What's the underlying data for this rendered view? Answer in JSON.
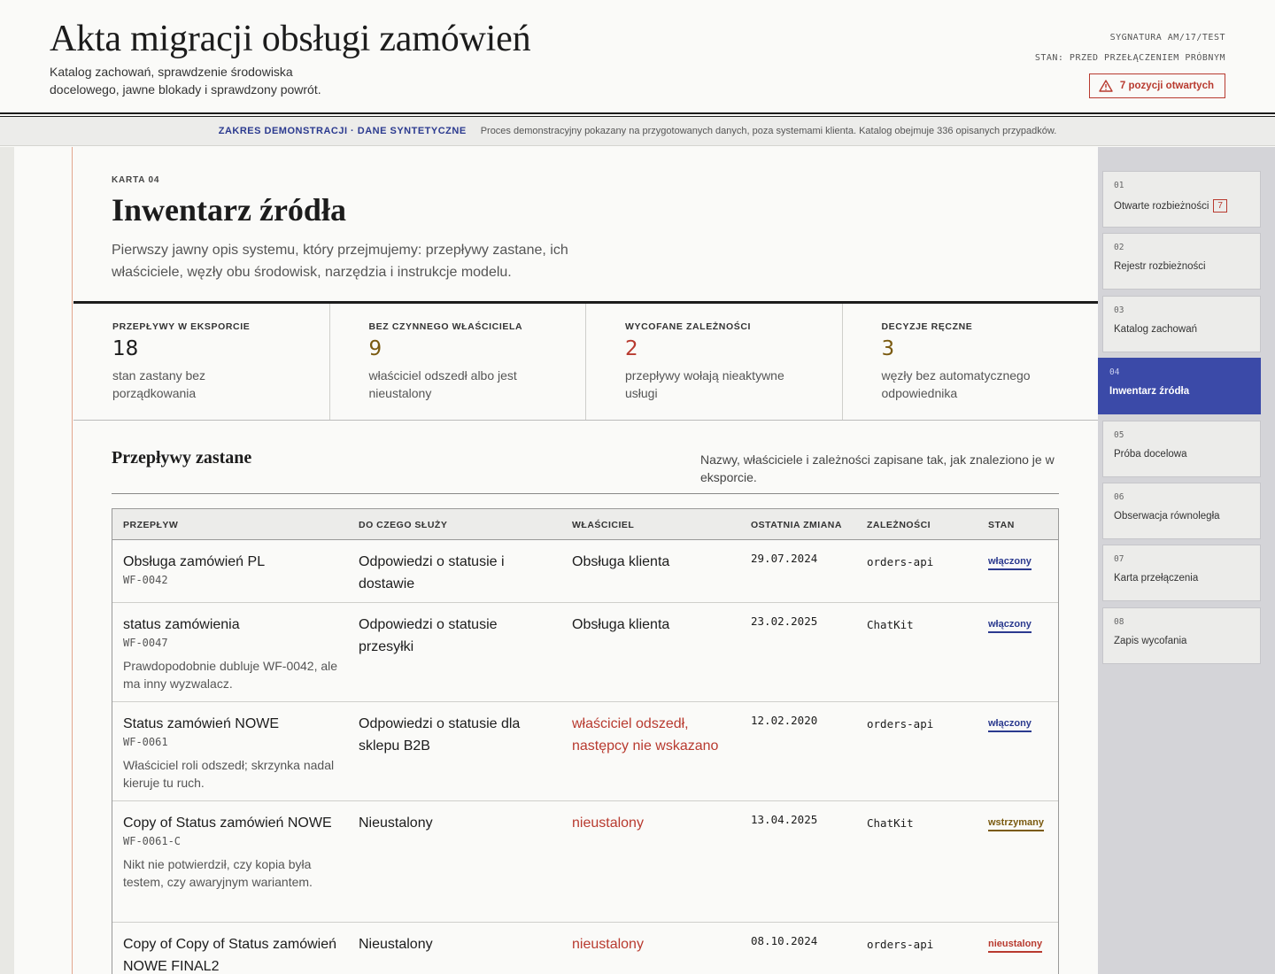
{
  "header": {
    "title": "Akta migracji obsługi zamówień",
    "subtitle": "Katalog zachowań, sprawdzenie środowiska docelowego, jawne blokady i sprawdzony powrót.",
    "signature": "SYGNATURA AM/17/TEST",
    "state": "STAN: PRZED PRZEŁĄCZENIEM PRÓBNYM",
    "open_items": "7 pozycji otwartych"
  },
  "scope": {
    "label": "ZAKRES DEMONSTRACJI · DANE SYNTETYCZNE",
    "text": "Proces demonstracyjny pokazany na przygotowanych danych, poza systemami klienta. Katalog obejmuje 336 opisanych przypadków."
  },
  "section": {
    "kicker": "KARTA 04",
    "title": "Inwentarz źródła",
    "description": "Pierwszy jawny opis systemu, który przejmujemy: przepływy zastane, ich właściciele, węzły obu środowisk, narzędzia i instrukcje modelu."
  },
  "stats": [
    {
      "label": "PRZEPŁYWY W EKSPORCIE",
      "value": "18",
      "note": "stan zastany bez porządkowania",
      "color": "#1c1c1c"
    },
    {
      "label": "BEZ CZYNNEGO WŁAŚCICIELA",
      "value": "9",
      "note": "właściciel odszedł albo jest nieustalony",
      "color": "#7a5a10"
    },
    {
      "label": "WYCOFANE ZALEŻNOŚCI",
      "value": "2",
      "note": "przepływy wołają nieaktywne usługi",
      "color": "#b83a2f"
    },
    {
      "label": "DECYZJE RĘCZNE",
      "value": "3",
      "note": "węzły bez automatycznego odpowiednika",
      "color": "#7a5a10"
    }
  ],
  "flows": {
    "title": "Przepływy zastane",
    "note": "Nazwy, właściciele i zależności zapisane tak, jak znaleziono je w eksporcie.",
    "columns": [
      "PRZEPŁYW",
      "DO CZEGO SŁUŻY",
      "WŁAŚCICIEL",
      "OSTATNIA ZMIANA",
      "ZALEŻNOŚCI",
      "STAN"
    ],
    "rows": [
      {
        "name": "Obsługa zamówień PL",
        "code": "WF-0042",
        "note": "",
        "purpose": "Odpowiedzi o statusie i dostawie",
        "owner": "Obsługa klienta",
        "owner_warn": false,
        "date": "29.07.2024",
        "dependency": "orders-api",
        "state": "włączony",
        "state_kind": "on"
      },
      {
        "name": "status zamówienia",
        "code": "WF-0047",
        "note": "Prawdopodobnie dubluje WF-0042, ale ma inny wyzwalacz.",
        "purpose": "Odpowiedzi o statusie przesyłki",
        "owner": "Obsługa klienta",
        "owner_warn": false,
        "date": "23.02.2025",
        "dependency": "ChatKit",
        "state": "włączony",
        "state_kind": "on"
      },
      {
        "name": "Status zamówień NOWE",
        "code": "WF-0061",
        "note": "Właściciel roli odszedł; skrzynka nadal kieruje tu ruch.",
        "purpose": "Odpowiedzi o statusie dla sklepu B2B",
        "owner": "właściciel odszedł, następcy nie wskazano",
        "owner_warn": true,
        "date": "12.02.2020",
        "dependency": "orders-api",
        "state": "włączony",
        "state_kind": "on"
      },
      {
        "name": "Copy of Status zamówień NOWE",
        "code": "WF-0061-C",
        "note": "Nikt nie potwierdził, czy kopia była testem, czy awaryjnym wariantem.",
        "purpose": "Nieustalony",
        "owner": "nieustalony",
        "owner_warn": true,
        "date": "13.04.2025",
        "dependency": "ChatKit",
        "state": "wstrzymany",
        "state_kind": "held"
      },
      {
        "name": "Copy of Copy of Status zamówień NOWE FINAL2",
        "code": "",
        "note": "",
        "purpose": "Nieustalony",
        "owner": "nieustalony",
        "owner_warn": true,
        "date": "08.10.2024",
        "dependency": "orders-api",
        "state": "nieustalony",
        "state_kind": "unk"
      }
    ]
  },
  "nav": [
    {
      "num": "01",
      "label": "Otwarte rozbieżności",
      "count": "7"
    },
    {
      "num": "02",
      "label": "Rejestr rozbieżności",
      "count": ""
    },
    {
      "num": "03",
      "label": "Katalog zachowań",
      "count": ""
    },
    {
      "num": "04",
      "label": "Inwentarz źródła",
      "count": "",
      "active": true
    },
    {
      "num": "05",
      "label": "Próba docelowa",
      "count": ""
    },
    {
      "num": "06",
      "label": "Obserwacja równoległa",
      "count": ""
    },
    {
      "num": "07",
      "label": "Karta przełączenia",
      "count": ""
    },
    {
      "num": "08",
      "label": "Zapis wycofania",
      "count": ""
    }
  ]
}
